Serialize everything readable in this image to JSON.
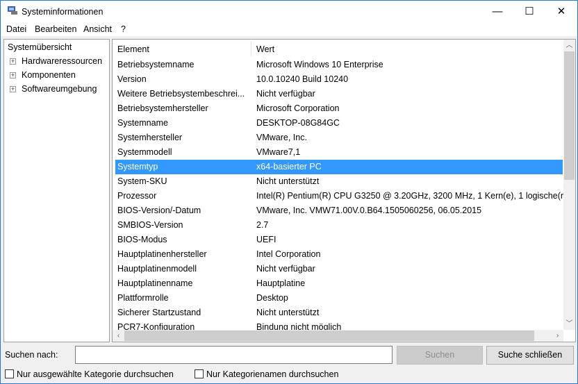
{
  "window": {
    "title": "Systeminformationen",
    "minimize": "—",
    "maximize": "☐",
    "close": "✕"
  },
  "menu": [
    "Datei",
    "Bearbeiten",
    "Ansicht",
    "?"
  ],
  "tree": {
    "root": "Systemübersicht",
    "children": [
      "Hardwareressourcen",
      "Komponenten",
      "Softwareumgebung"
    ]
  },
  "table": {
    "headers": [
      "Element",
      "Wert"
    ],
    "selected_index": 7,
    "rows": [
      [
        "Betriebsystemname",
        "Microsoft Windows 10 Enterprise"
      ],
      [
        "Version",
        "10.0.10240 Build 10240"
      ],
      [
        "Weitere Betriebsystembeschrei...",
        "Nicht verfügbar"
      ],
      [
        "Betriebsystemhersteller",
        "Microsoft Corporation"
      ],
      [
        "Systemname",
        "DESKTOP-08G84GC"
      ],
      [
        "Systemhersteller",
        "VMware, Inc."
      ],
      [
        "Systemmodell",
        "VMware7,1"
      ],
      [
        "Systemtyp",
        "x64-basierter PC"
      ],
      [
        "System-SKU",
        "Nicht unterstützt"
      ],
      [
        "Prozessor",
        "Intel(R) Pentium(R) CPU G3250 @ 3.20GHz, 3200 MHz, 1 Kern(e), 1 logische(r"
      ],
      [
        "BIOS-Version/-Datum",
        "VMware, Inc. VMW71.00V.0.B64.1505060256, 06.05.2015"
      ],
      [
        "SMBIOS-Version",
        "2.7"
      ],
      [
        "BIOS-Modus",
        "UEFI"
      ],
      [
        "Hauptplatinenhersteller",
        "Intel Corporation"
      ],
      [
        "Hauptplatinenmodell",
        "Nicht verfügbar"
      ],
      [
        "Hauptplatinenname",
        "Hauptplatine"
      ],
      [
        "Plattformrolle",
        "Desktop"
      ],
      [
        "Sicherer Startzustand",
        "Nicht unterstützt"
      ],
      [
        "PCR7-Konfiguration",
        "Bindung nicht möglich"
      ]
    ]
  },
  "search": {
    "label": "Suchen nach:",
    "value": "",
    "search_button": "Suchen",
    "close_button": "Suche schließen",
    "check1": "Nur ausgewählte Kategorie durchsuchen",
    "check2": "Nur Kategorienamen durchsuchen"
  },
  "colors": {
    "selection": "#3399ff"
  }
}
